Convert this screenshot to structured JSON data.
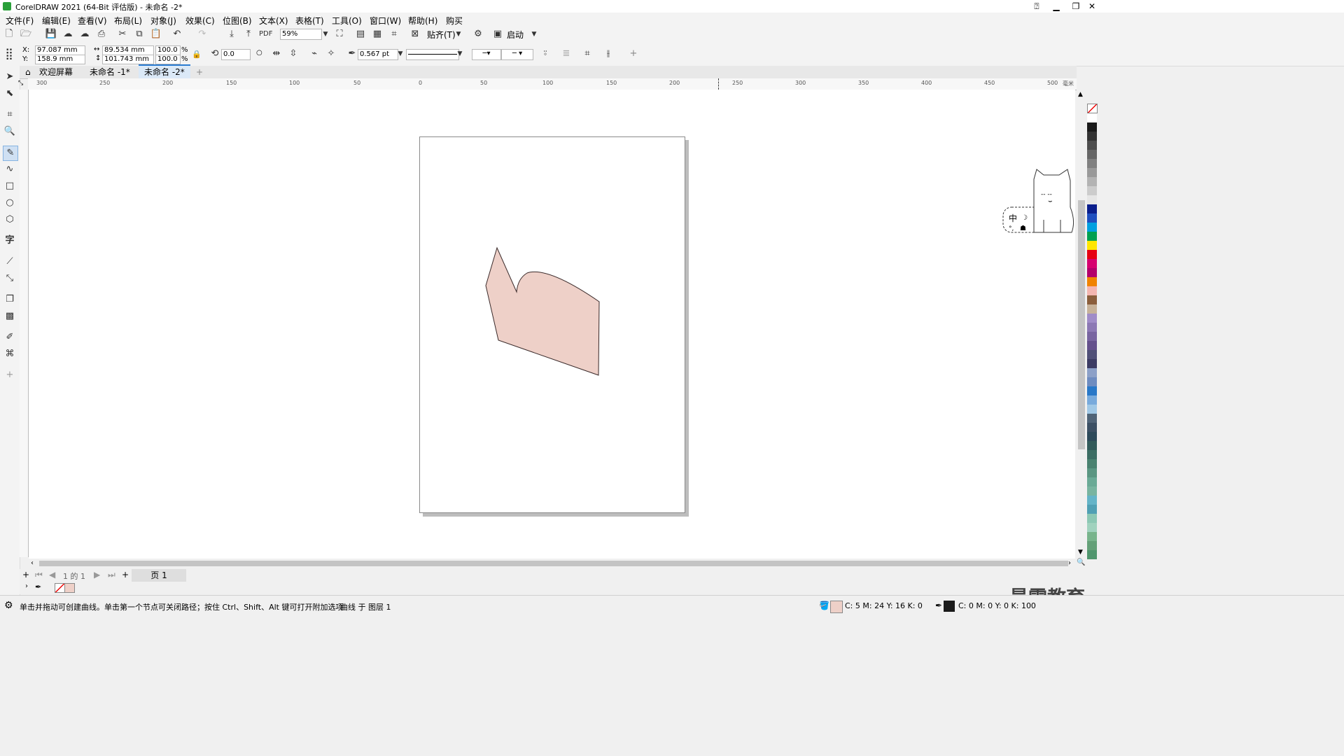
{
  "window": {
    "title": "CorelDRAW 2021 (64-Bit 评估版) - 未命名 -2*"
  },
  "menu": [
    "文件(F)",
    "编辑(E)",
    "查看(V)",
    "布局(L)",
    "对象(J)",
    "效果(C)",
    "位图(B)",
    "文本(X)",
    "表格(T)",
    "工具(O)",
    "窗口(W)",
    "帮助(H)",
    "购买"
  ],
  "toolbar": {
    "zoom": "59%",
    "snap_label": "贴齐(T)",
    "launch_label": "启动"
  },
  "props": {
    "x_label": "X:",
    "x": "97.087 mm",
    "y_label": "Y:",
    "y": "158.9 mm",
    "w": "89.534 mm",
    "h": "101.743 mm",
    "sx": "100.0",
    "sy": "100.0",
    "pct": "%",
    "rotation": "0.0",
    "outline_width": "0.567 pt"
  },
  "tabs": [
    {
      "label": "欢迎屏幕"
    },
    {
      "label": "未命名 -1*"
    },
    {
      "label": "未命名 -2*"
    }
  ],
  "ruler": {
    "top": [
      "300",
      "250",
      "200",
      "150",
      "100",
      "50",
      "0",
      "50",
      "100",
      "150",
      "200",
      "250",
      "300",
      "350",
      "400",
      "450",
      "500"
    ],
    "unit": "毫米"
  },
  "pagenav": {
    "of_text": "1 的 1",
    "page_tab": "页 1"
  },
  "status": {
    "hint": "单击并拖动可创建曲线。单击第一个节点可关闭路径；按住 Ctrl、Shift、Alt 键可打开附加选项",
    "object": "曲线 于 图层 1",
    "fill_cmyk": "C: 5 M: 24 Y: 16 K: 0",
    "outline_cmyk": "C: 0 M: 0 Y: 0 K: 100"
  },
  "colors": {
    "shape_fill": "#eed0c8",
    "shape_outline": "#3a2a2a"
  },
  "palette": [
    "#ffffff",
    "#1a1a1a",
    "#333333",
    "#4d4d4d",
    "#666666",
    "#808080",
    "#999999",
    "#b3b3b3",
    "#cccccc",
    "#e6e6e6",
    "#0a1e8c",
    "#1f4fbf",
    "#00a0e0",
    "#00a050",
    "#ffe600",
    "#e60012",
    "#d6006f",
    "#b3006b",
    "#f08300",
    "#f4b6b0",
    "#8b5e3c",
    "#c7b299",
    "#a08cc8",
    "#8c78b4",
    "#7864a0",
    "#64508c",
    "#505078",
    "#3c3c64",
    "#8ca0c8",
    "#6e8cc0",
    "#2878c8",
    "#78aadc",
    "#a0c8e6",
    "#506478",
    "#3c5064",
    "#2d4a5a",
    "#325a5a",
    "#3c6e64",
    "#4a8270",
    "#5a9682",
    "#6aaa96",
    "#78b4a0",
    "#64b4c8",
    "#50a0b4",
    "#8cc8b4",
    "#a0d2be",
    "#78b48c",
    "#64a078",
    "#50966e"
  ],
  "watermark": "最需教育"
}
